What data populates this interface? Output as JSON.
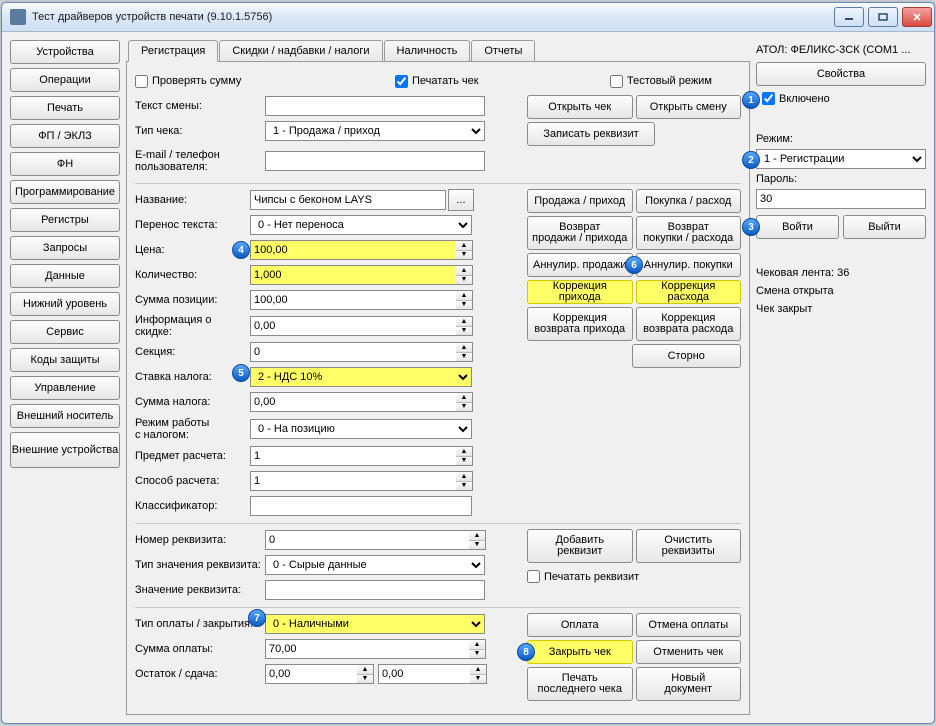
{
  "window": {
    "title": "Тест драйверов устройств печати (9.10.1.5756)"
  },
  "sidebar": [
    "Устройства",
    "Операции",
    "Печать",
    "ФП / ЭКЛЗ",
    "ФН",
    "Программирование",
    "Регистры",
    "Запросы",
    "Данные",
    "Нижний уровень",
    "Сервис",
    "Коды защиты",
    "Управление",
    "Внешний носитель",
    "Внешние\nустройства"
  ],
  "tabs": [
    "Регистрация",
    "Скидки / надбавки / налоги",
    "Наличность",
    "Отчеты"
  ],
  "form": {
    "check_sum": "Проверять сумму",
    "print_check": "Печатать чек",
    "test_mode": "Тестовый режим",
    "shift_text_lbl": "Текст смены:",
    "check_type_lbl": "Тип чека:",
    "check_type_val": "1 - Продажа / приход",
    "email_lbl": "E-mail / телефон\nпользователя:",
    "name_lbl": "Название:",
    "name_val": "Чипсы с беконом LAYS",
    "wrap_lbl": "Перенос текста:",
    "wrap_val": "0 - Нет переноса",
    "price_lbl": "Цена:",
    "price_val": "100,00",
    "qty_lbl": "Количество:",
    "qty_val": "1,000",
    "pos_sum_lbl": "Сумма позиции:",
    "pos_sum_val": "100,00",
    "disc_info_lbl": "Информация о скидке:",
    "disc_info_val": "0,00",
    "section_lbl": "Секция:",
    "section_val": "0",
    "tax_lbl": "Ставка налога:",
    "tax_val": "2 - НДС 10%",
    "tax_sum_lbl": "Сумма налога:",
    "tax_sum_val": "0,00",
    "tax_mode_lbl": "Режим работы\nс налогом:",
    "tax_mode_val": "0 - На позицию",
    "calc_subj_lbl": "Предмет расчета:",
    "calc_subj_val": "1",
    "calc_meth_lbl": "Способ расчета:",
    "calc_meth_val": "1",
    "class_lbl": "Классификатор:",
    "req_num_lbl": "Номер реквизита:",
    "req_num_val": "0",
    "req_type_lbl": "Тип значения реквизита:",
    "req_type_val": "0 - Сырые данные",
    "req_val_lbl": "Значение реквизита:",
    "print_req": "Печатать реквизит",
    "pay_type_lbl": "Тип оплаты / закрытия:",
    "pay_type_val": "0 - Наличными",
    "pay_sum_lbl": "Сумма оплаты:",
    "pay_sum_val": "70,00",
    "rest_lbl": "Остаток / сдача:",
    "rest_val1": "0,00",
    "rest_val2": "0,00"
  },
  "btns": {
    "open_check": "Открыть чек",
    "open_shift": "Открыть смену",
    "write_req": "Записать реквизит",
    "sale": "Продажа / приход",
    "buy": "Покупка / расход",
    "ret_sale": "Возврат\nпродажи / прихода",
    "ret_buy": "Возврат\nпокупки / расхода",
    "ann_sale": "Аннулир. продажи",
    "ann_buy": "Аннулир. покупки",
    "corr_in": "Коррекция прихода",
    "corr_out": "Коррекция расхода",
    "corr_ret_in": "Коррекция\nвозврата прихода",
    "corr_ret_out": "Коррекция\nвозврата расхода",
    "storno": "Сторно",
    "add_req": "Добавить\nреквизит",
    "clear_req": "Очистить\nреквизиты",
    "pay": "Оплата",
    "cancel_pay": "Отмена оплаты",
    "close_check": "Закрыть чек",
    "cancel_check": "Отменить чек",
    "print_last": "Печать\nпоследнего чека",
    "new_doc": "Новый\nдокумент"
  },
  "rpanel": {
    "device": "АТОЛ: ФЕЛИКС-3СК (COM1 ...",
    "props": "Свойства",
    "enabled": "Включено",
    "mode_lbl": "Режим:",
    "mode_val": "1 - Регистрации",
    "pwd_lbl": "Пароль:",
    "pwd_val": "30",
    "login": "Войти",
    "logout": "Выйти",
    "status1": "Чековая лента: 36",
    "status2": "Смена открыта",
    "status3": "Чек закрыт"
  }
}
